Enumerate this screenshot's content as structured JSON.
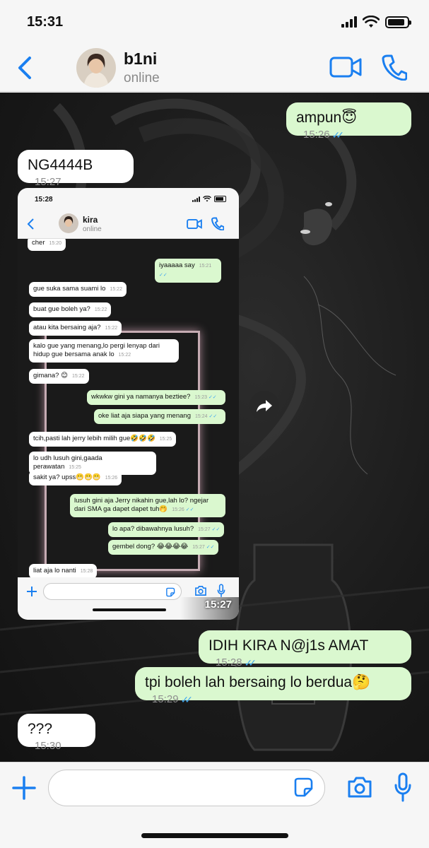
{
  "status_bar": {
    "time": "15:31"
  },
  "contact": {
    "name": "b1ni",
    "status": "online"
  },
  "messages": [
    {
      "dir": "out",
      "text": "ampun😇",
      "time": "15:26",
      "read": true
    },
    {
      "dir": "in",
      "text": "NG4444B",
      "time": "15:27"
    },
    {
      "dir": "out",
      "text": "IDIH KIRA N@j1s AMAT",
      "time": "15:28",
      "read": true
    },
    {
      "dir": "out",
      "text": "tpi boleh lah bersaing lo berdua🤔",
      "time": "15:29",
      "read": true
    },
    {
      "dir": "in",
      "text": "???",
      "time": "15:30"
    }
  ],
  "image_message": {
    "time": "15:27",
    "screenshot": {
      "status_time": "15:28",
      "contact_name": "kira",
      "contact_status": "online",
      "messages": [
        {
          "dir": "in",
          "text": "cher",
          "time": "15:20"
        },
        {
          "dir": "out",
          "text": "iyaaaaa say",
          "time": "15:21"
        },
        {
          "dir": "in",
          "text": "gue suka sama suami lo",
          "time": "15:22"
        },
        {
          "dir": "in",
          "text": "buat gue boleh ya?",
          "time": "15:22"
        },
        {
          "dir": "in",
          "text": "atau kita bersaing aja?",
          "time": "15:22"
        },
        {
          "dir": "in",
          "text": "kalo gue yang menang,lo pergi lenyap dari hidup gue bersama anak lo",
          "time": "15:22"
        },
        {
          "dir": "in",
          "text": "gimana? 😊",
          "time": "15:22"
        },
        {
          "dir": "out",
          "text": "wkwkw gini ya namanya beztiee?",
          "time": "15:23"
        },
        {
          "dir": "out",
          "text": "oke liat aja siapa yang menang",
          "time": "15:24"
        },
        {
          "dir": "in",
          "text": "tcih,pasti lah jerry lebih milih gue🤣🤣🤣",
          "time": "15:25"
        },
        {
          "dir": "in",
          "text": "lo udh lusuh gini,gaada perawatan",
          "time": "15:25"
        },
        {
          "dir": "in",
          "text": "sakit ya? upss😬😬😬",
          "time": "15:26"
        },
        {
          "dir": "out",
          "text": "lusuh gini aja Jerry nikahin gue,lah lo? ngejar dari SMA ga dapet dapet tuh🤭",
          "time": "15:26"
        },
        {
          "dir": "out",
          "text": "lo apa? dibawahnya lusuh?",
          "time": "15:27"
        },
        {
          "dir": "out",
          "text": "gembel dong? 😂😂😂😂",
          "time": "15:27"
        },
        {
          "dir": "in",
          "text": "liat aja lo nanti",
          "time": "15:28"
        }
      ]
    }
  },
  "colors": {
    "accent": "#1a7ff0",
    "outgoing": "#daf8cf",
    "incoming": "#ffffff",
    "ticks": "#3ea6f0"
  },
  "icons": [
    "back-chevron-icon",
    "video-call-icon",
    "phone-icon",
    "forward-icon",
    "plus-icon",
    "sticker-icon",
    "camera-icon",
    "mic-icon"
  ]
}
